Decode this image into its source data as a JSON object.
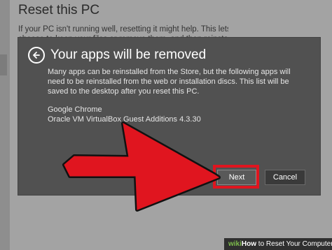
{
  "background_page": {
    "title": "Reset this PC",
    "description_lines": [
      "If your PC isn't running well, resetting it might help. This lets you",
      "choose to keep your files or remove them, and then reinstalls"
    ]
  },
  "dialog": {
    "title": "Your apps will be removed",
    "message": "Many apps can be reinstalled from the Store, but the following apps will need to be reinstalled from the web or installation discs. This list will be saved to the desktop after you reset this PC.",
    "apps": [
      "Google Chrome",
      "Oracle VM VirtualBox Guest Additions 4.3.30"
    ],
    "next_label": "Next",
    "cancel_label": "Cancel"
  },
  "watermark": {
    "prefix": "wiki",
    "how": "How",
    "text": " to Reset Your Computer"
  },
  "colors": {
    "arrow": "#e0151f",
    "highlight": "#e0151f",
    "dialog_bg": "#515151",
    "footer_brand": "#7dbb4c"
  },
  "icons": {
    "back": "back-arrow-circle-icon",
    "annotation": "red-pointer-arrow"
  }
}
